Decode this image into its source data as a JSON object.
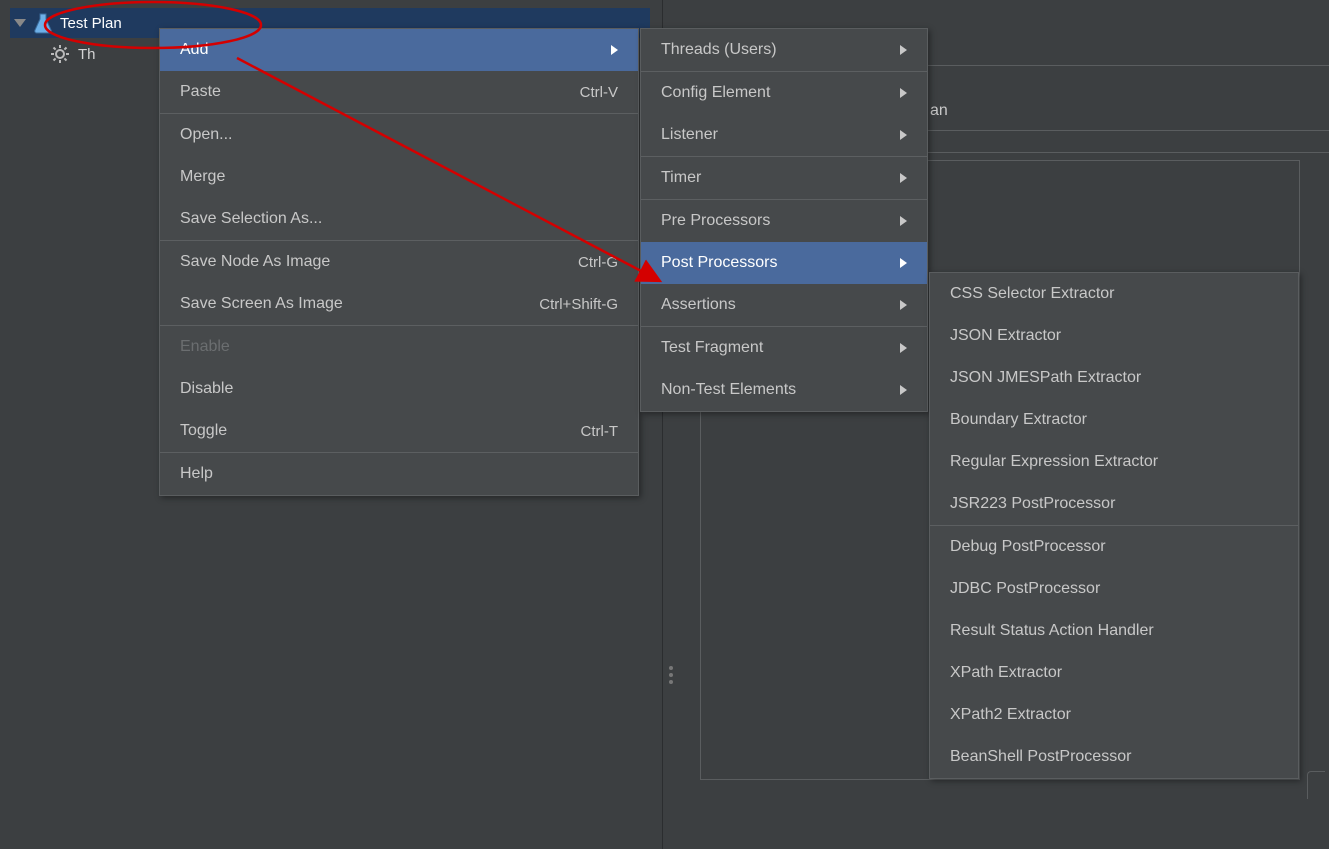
{
  "tree": {
    "root_label": "Test Plan",
    "child_label": "Th"
  },
  "background": {
    "partial_text": "an"
  },
  "context_menu": {
    "items": [
      {
        "label": "Add",
        "shortcut": "",
        "submenu": true,
        "highlight": true
      },
      {
        "label": "Paste",
        "shortcut": "Ctrl-V"
      },
      {
        "sep": true
      },
      {
        "label": "Open...",
        "shortcut": ""
      },
      {
        "label": "Merge",
        "shortcut": ""
      },
      {
        "label": "Save Selection As...",
        "shortcut": ""
      },
      {
        "sep": true
      },
      {
        "label": "Save Node As Image",
        "shortcut": "Ctrl-G"
      },
      {
        "label": "Save Screen As Image",
        "shortcut": "Ctrl+Shift-G"
      },
      {
        "sep": true
      },
      {
        "label": "Enable",
        "shortcut": "",
        "disabled": true
      },
      {
        "label": "Disable",
        "shortcut": ""
      },
      {
        "label": "Toggle",
        "shortcut": "Ctrl-T"
      },
      {
        "sep": true
      },
      {
        "label": "Help",
        "shortcut": ""
      }
    ]
  },
  "add_submenu": {
    "items": [
      {
        "label": "Threads (Users)",
        "submenu": true
      },
      {
        "sep": true
      },
      {
        "label": "Config Element",
        "submenu": true
      },
      {
        "label": "Listener",
        "submenu": true
      },
      {
        "sep": true
      },
      {
        "label": "Timer",
        "submenu": true
      },
      {
        "sep": true
      },
      {
        "label": "Pre Processors",
        "submenu": true
      },
      {
        "label": "Post Processors",
        "submenu": true,
        "highlight": true
      },
      {
        "label": "Assertions",
        "submenu": true
      },
      {
        "sep": true
      },
      {
        "label": "Test Fragment",
        "submenu": true
      },
      {
        "label": "Non-Test Elements",
        "submenu": true
      }
    ]
  },
  "post_processors_submenu": {
    "items": [
      {
        "label": "CSS Selector Extractor"
      },
      {
        "label": "JSON Extractor"
      },
      {
        "label": "JSON JMESPath Extractor"
      },
      {
        "label": "Boundary Extractor"
      },
      {
        "label": "Regular Expression Extractor"
      },
      {
        "label": "JSR223 PostProcessor"
      },
      {
        "sep": true
      },
      {
        "label": "Debug PostProcessor"
      },
      {
        "label": "JDBC PostProcessor"
      },
      {
        "label": "Result Status Action Handler"
      },
      {
        "label": "XPath Extractor"
      },
      {
        "label": "XPath2 Extractor"
      },
      {
        "label": "BeanShell PostProcessor"
      }
    ]
  }
}
